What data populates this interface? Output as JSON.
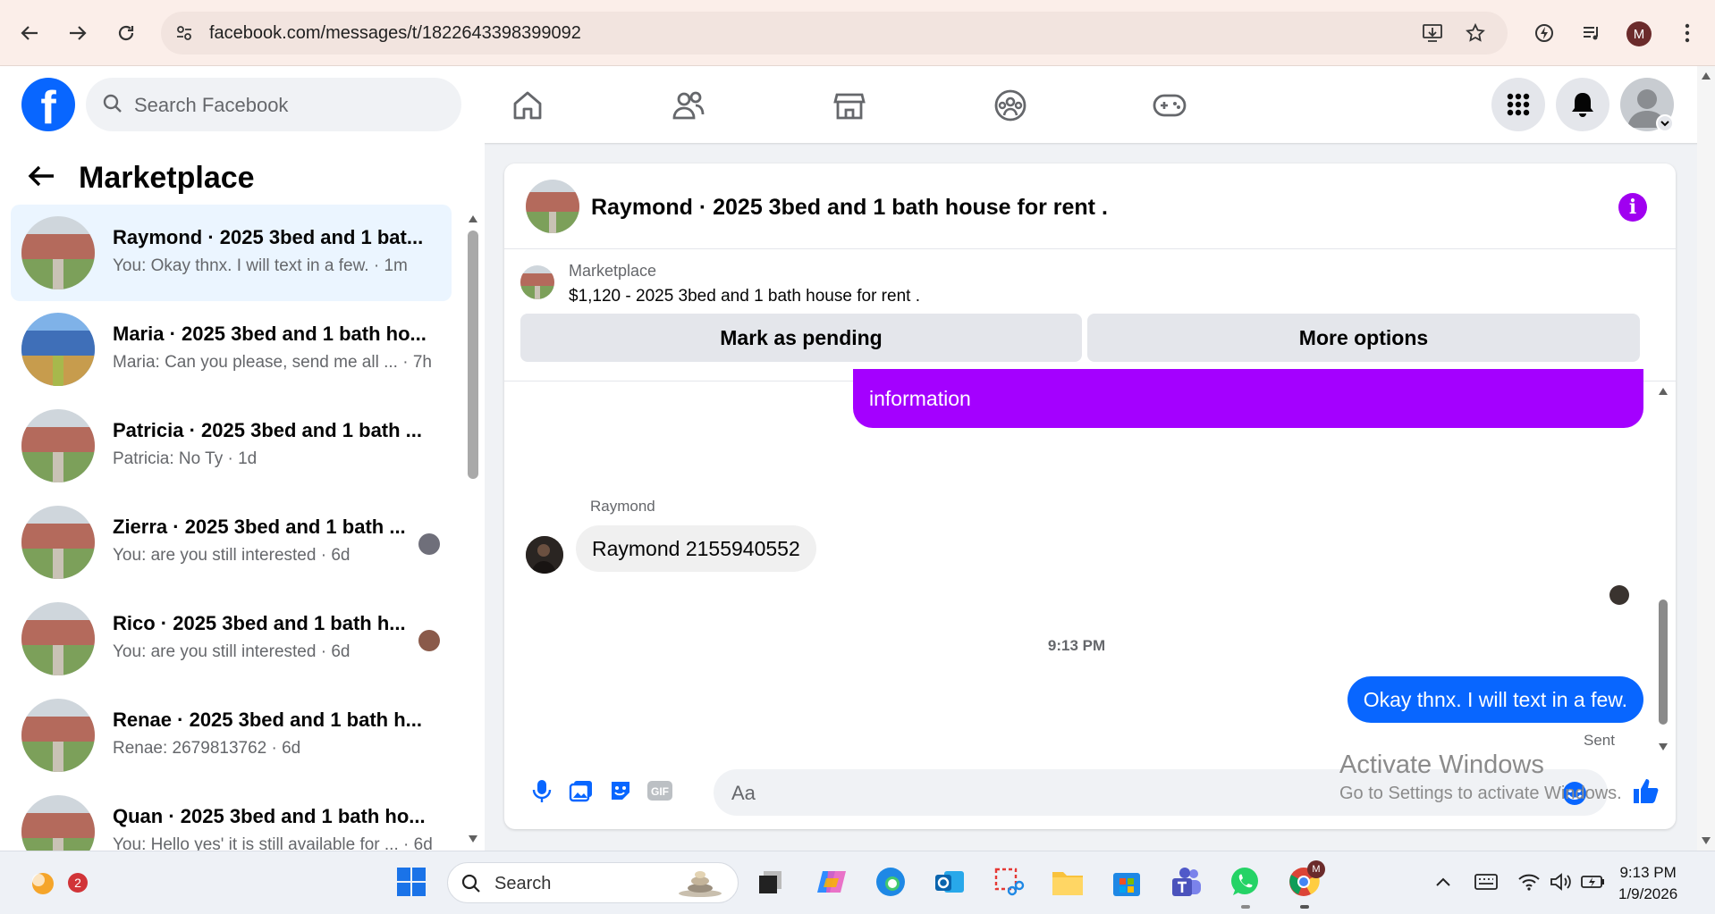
{
  "browser": {
    "url": "facebook.com/messages/t/1822643398399092",
    "profile_initial": "M"
  },
  "fb": {
    "search_placeholder": "Search Facebook",
    "logo_letter": "f"
  },
  "left": {
    "title": "Marketplace",
    "conversations": [
      {
        "name": "Raymond · 2025 3bed and 1 bat...",
        "preview": "You: Okay thnx. I will text in a few.",
        "time": "1m"
      },
      {
        "name": "Maria · 2025 3bed and 1 bath ho...",
        "preview": "Maria: Can you please, send me all ...",
        "time": "7h"
      },
      {
        "name": "Patricia · 2025 3bed and 1 bath ...",
        "preview": "Patricia: No Ty",
        "time": "1d"
      },
      {
        "name": "Zierra · 2025 3bed and 1 bath ...",
        "preview": "You: are you still interested",
        "time": "6d"
      },
      {
        "name": "Rico · 2025 3bed and 1 bath h...",
        "preview": "You: are you still interested",
        "time": "6d"
      },
      {
        "name": "Renae · 2025 3bed and 1 bath h...",
        "preview": "Renae: 2679813762",
        "time": "6d"
      },
      {
        "name": "Quan · 2025 3bed and 1 bath ho...",
        "preview": "You: Hello yes' it is still available for ...",
        "time": "6d"
      }
    ]
  },
  "chat": {
    "title": "Raymond · 2025 3bed and 1 bath house for rent .",
    "listing_source": "Marketplace",
    "listing_title": "$1,120 - 2025 3bed and 1 bath house for rent .",
    "mark_pending": "Mark as pending",
    "more_options": "More options",
    "outgoing_partial": "information",
    "sender_name": "Raymond",
    "incoming_message": "Raymond 2155940552",
    "timestamp": "9:13 PM",
    "outgoing_message": "Okay thnx. I will text in a few.",
    "sent_label": "Sent",
    "composer_placeholder": "Aa"
  },
  "watermark": {
    "line1": "Activate Windows",
    "line2": "Go to Settings to activate Windows."
  },
  "taskbar": {
    "search_placeholder": "Search",
    "widget_badge": "2",
    "time": "9:13 PM",
    "date": "1/9/2026"
  },
  "colors": {
    "fb_blue": "#0866ff",
    "purple": "#a400ff",
    "active_row": "#ebf5ff"
  }
}
